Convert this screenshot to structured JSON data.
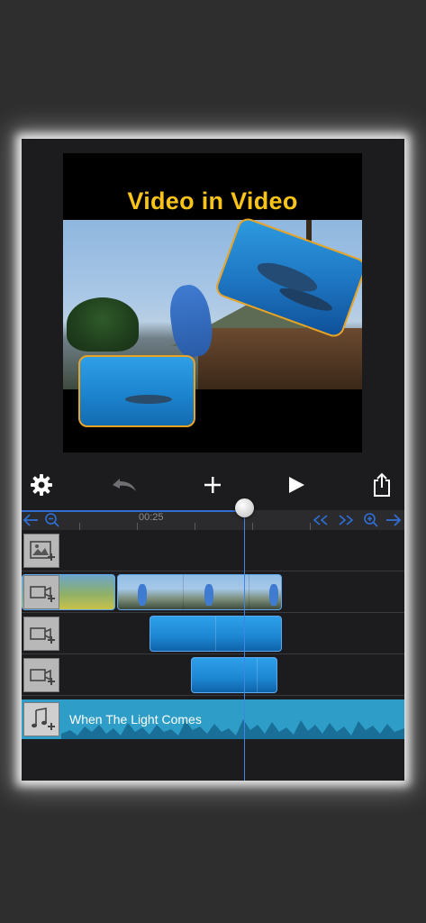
{
  "preview": {
    "title": "Video in Video"
  },
  "toolbar": {
    "settings_icon": "gear-icon",
    "undo_icon": "undo-icon",
    "add_icon": "plus-icon",
    "play_icon": "play-icon",
    "share_icon": "share-icon"
  },
  "timeline": {
    "timecode": "00:25",
    "playhead_progress": 0.58
  },
  "tracks": [
    {
      "type": "image",
      "icon": "add-image-icon"
    },
    {
      "type": "video",
      "icon": "add-video-icon"
    },
    {
      "type": "video",
      "icon": "add-video-icon"
    },
    {
      "type": "video",
      "icon": "add-video-icon"
    }
  ],
  "audio": {
    "title": "When The Light Comes",
    "icon": "add-music-icon"
  },
  "colors": {
    "accent": "#2f6fd6",
    "title_yellow": "#f7c417",
    "frame_orange": "#e7a424",
    "audio_track": "#2e9dc8"
  }
}
